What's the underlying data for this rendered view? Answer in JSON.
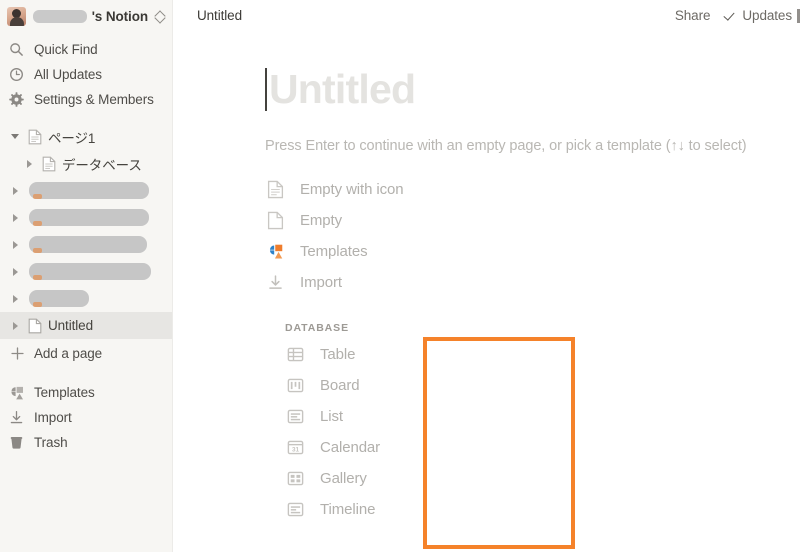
{
  "workspace": {
    "name_suffix": "'s Notion",
    "name_redacted": true,
    "avatar": "user-avatar",
    "switcher_icon": "chevron-up-down-icon"
  },
  "sidebar": {
    "nav": [
      {
        "label": "Quick Find",
        "icon": "search-icon"
      },
      {
        "label": "All Updates",
        "icon": "clock-icon"
      },
      {
        "label": "Settings & Members",
        "icon": "gear-icon"
      }
    ],
    "tree": [
      {
        "label": "ページ1",
        "icon": "page-icon",
        "toggle": "open",
        "indent": 0,
        "redacted": false,
        "selected": false
      },
      {
        "label": "データベース",
        "icon": "page-icon",
        "toggle": "closed",
        "indent": 1,
        "redacted": false,
        "selected": false
      },
      {
        "label": "",
        "icon": "page-icon",
        "toggle": "closed",
        "indent": 0,
        "redacted": true,
        "redact_width": 120,
        "selected": false
      },
      {
        "label": "",
        "icon": "page-icon",
        "toggle": "closed",
        "indent": 0,
        "redacted": true,
        "redact_width": 120,
        "selected": false
      },
      {
        "label": "",
        "icon": "page-icon",
        "toggle": "closed",
        "indent": 0,
        "redacted": true,
        "redact_width": 118,
        "selected": false
      },
      {
        "label": "",
        "icon": "page-icon",
        "toggle": "closed",
        "indent": 0,
        "redacted": true,
        "redact_width": 120,
        "selected": false
      },
      {
        "label": "",
        "icon": "page-icon",
        "toggle": "closed",
        "indent": 0,
        "redacted": true,
        "redact_width": 60,
        "selected": false
      },
      {
        "label": "Untitled",
        "icon": "page-icon",
        "toggle": "closed",
        "indent": 0,
        "redacted": false,
        "selected": true
      }
    ],
    "add_page": {
      "label": "Add a page",
      "icon": "plus-icon"
    },
    "bottom": [
      {
        "label": "Templates",
        "icon": "templates-icon"
      },
      {
        "label": "Import",
        "icon": "import-icon"
      },
      {
        "label": "Trash",
        "icon": "trash-icon"
      }
    ]
  },
  "topbar": {
    "breadcrumb": "Untitled",
    "share_label": "Share",
    "updates_label": "Updates",
    "updates_icon": "check-icon"
  },
  "page": {
    "title_placeholder": "Untitled",
    "caret_visible": true,
    "hint": "Press Enter to continue with an empty page, or pick a template (↑↓ to select)",
    "options": [
      {
        "label": "Empty with icon",
        "icon": "page-with-icon-icon"
      },
      {
        "label": "Empty",
        "icon": "blank-page-icon"
      },
      {
        "label": "Templates",
        "icon": "templates-color-icon"
      },
      {
        "label": "Import",
        "icon": "import-icon"
      }
    ],
    "database": {
      "header": "DATABASE",
      "items": [
        {
          "label": "Table",
          "icon": "table-icon"
        },
        {
          "label": "Board",
          "icon": "board-icon"
        },
        {
          "label": "List",
          "icon": "list-icon"
        },
        {
          "label": "Calendar",
          "icon": "calendar-icon"
        },
        {
          "label": "Gallery",
          "icon": "gallery-icon"
        },
        {
          "label": "Timeline",
          "icon": "timeline-icon"
        }
      ]
    }
  },
  "annotation": {
    "shape": "rectangle",
    "color": "#f5822a",
    "target": "database-section"
  }
}
